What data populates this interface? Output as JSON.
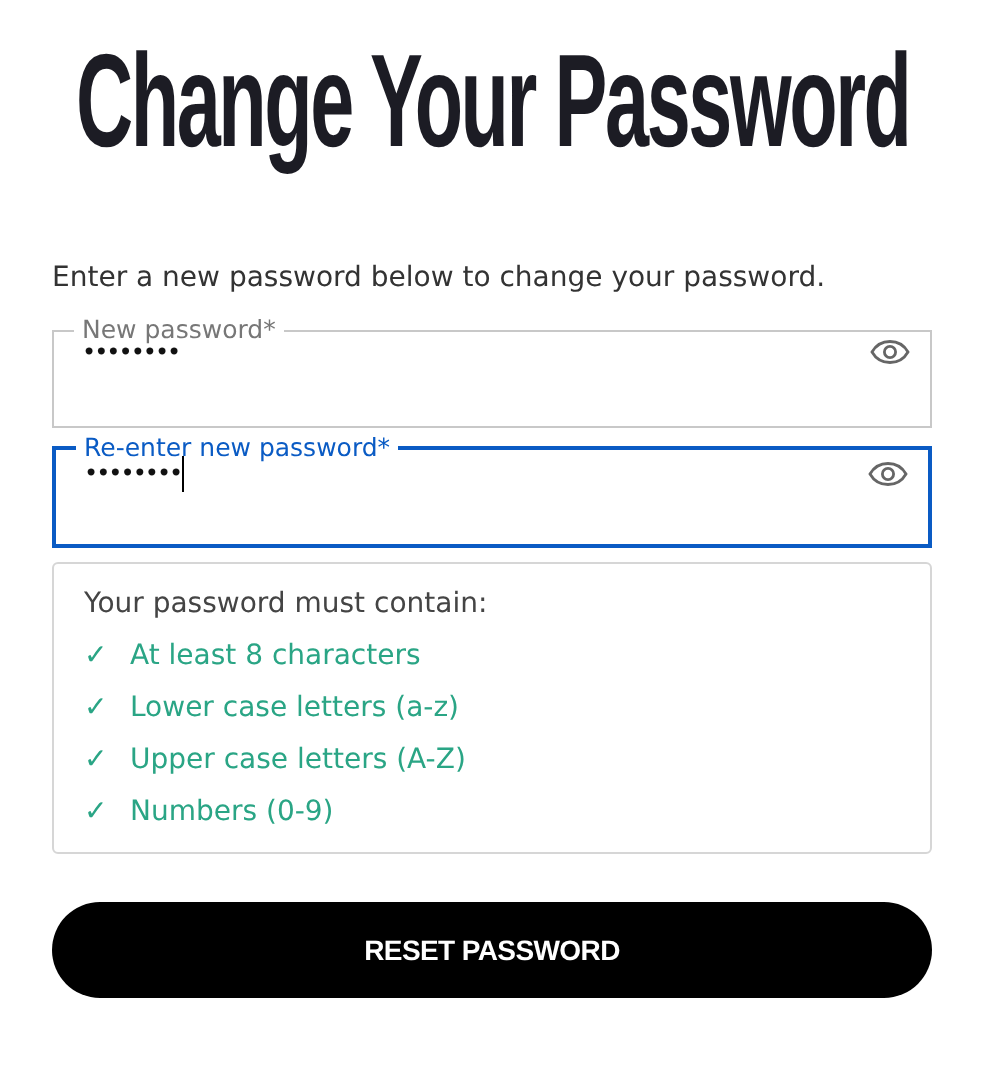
{
  "title": "Change Your Password",
  "intro": "Enter a new password below to change your password.",
  "fields": [
    {
      "label": "New password*",
      "value": "••••••••",
      "focused": false
    },
    {
      "label": "Re-enter new password*",
      "value": "••••••••",
      "focused": true
    }
  ],
  "requirements": {
    "heading": "Your password must contain:",
    "items": [
      {
        "mark": "✓",
        "text": "At least 8 characters",
        "met": true
      },
      {
        "mark": "✓",
        "text": "Lower case letters (a-z)",
        "met": true
      },
      {
        "mark": "✓",
        "text": "Upper case letters (A-Z)",
        "met": true
      },
      {
        "mark": "✓",
        "text": "Numbers (0-9)",
        "met": true
      }
    ]
  },
  "button": "RESET PASSWORD"
}
